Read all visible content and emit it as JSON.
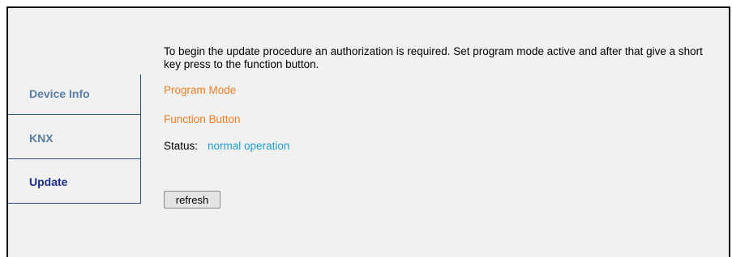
{
  "tabs": {
    "device_info": "Device Info",
    "knx": "KNX",
    "update": "Update"
  },
  "content": {
    "intro": "To begin the update procedure an authorization is required. Set program mode active and after that give a short key press to the function button.",
    "program_mode": "Program Mode",
    "function_button": "Function Button",
    "status_label": "Status:",
    "status_value": "normal operation",
    "refresh_label": "refresh"
  },
  "colors": {
    "link_orange": "#f07e26",
    "status_blue": "#1e9fd0",
    "tab_text": "#5a7fa7",
    "tab_active_text": "#1b2f8a"
  }
}
